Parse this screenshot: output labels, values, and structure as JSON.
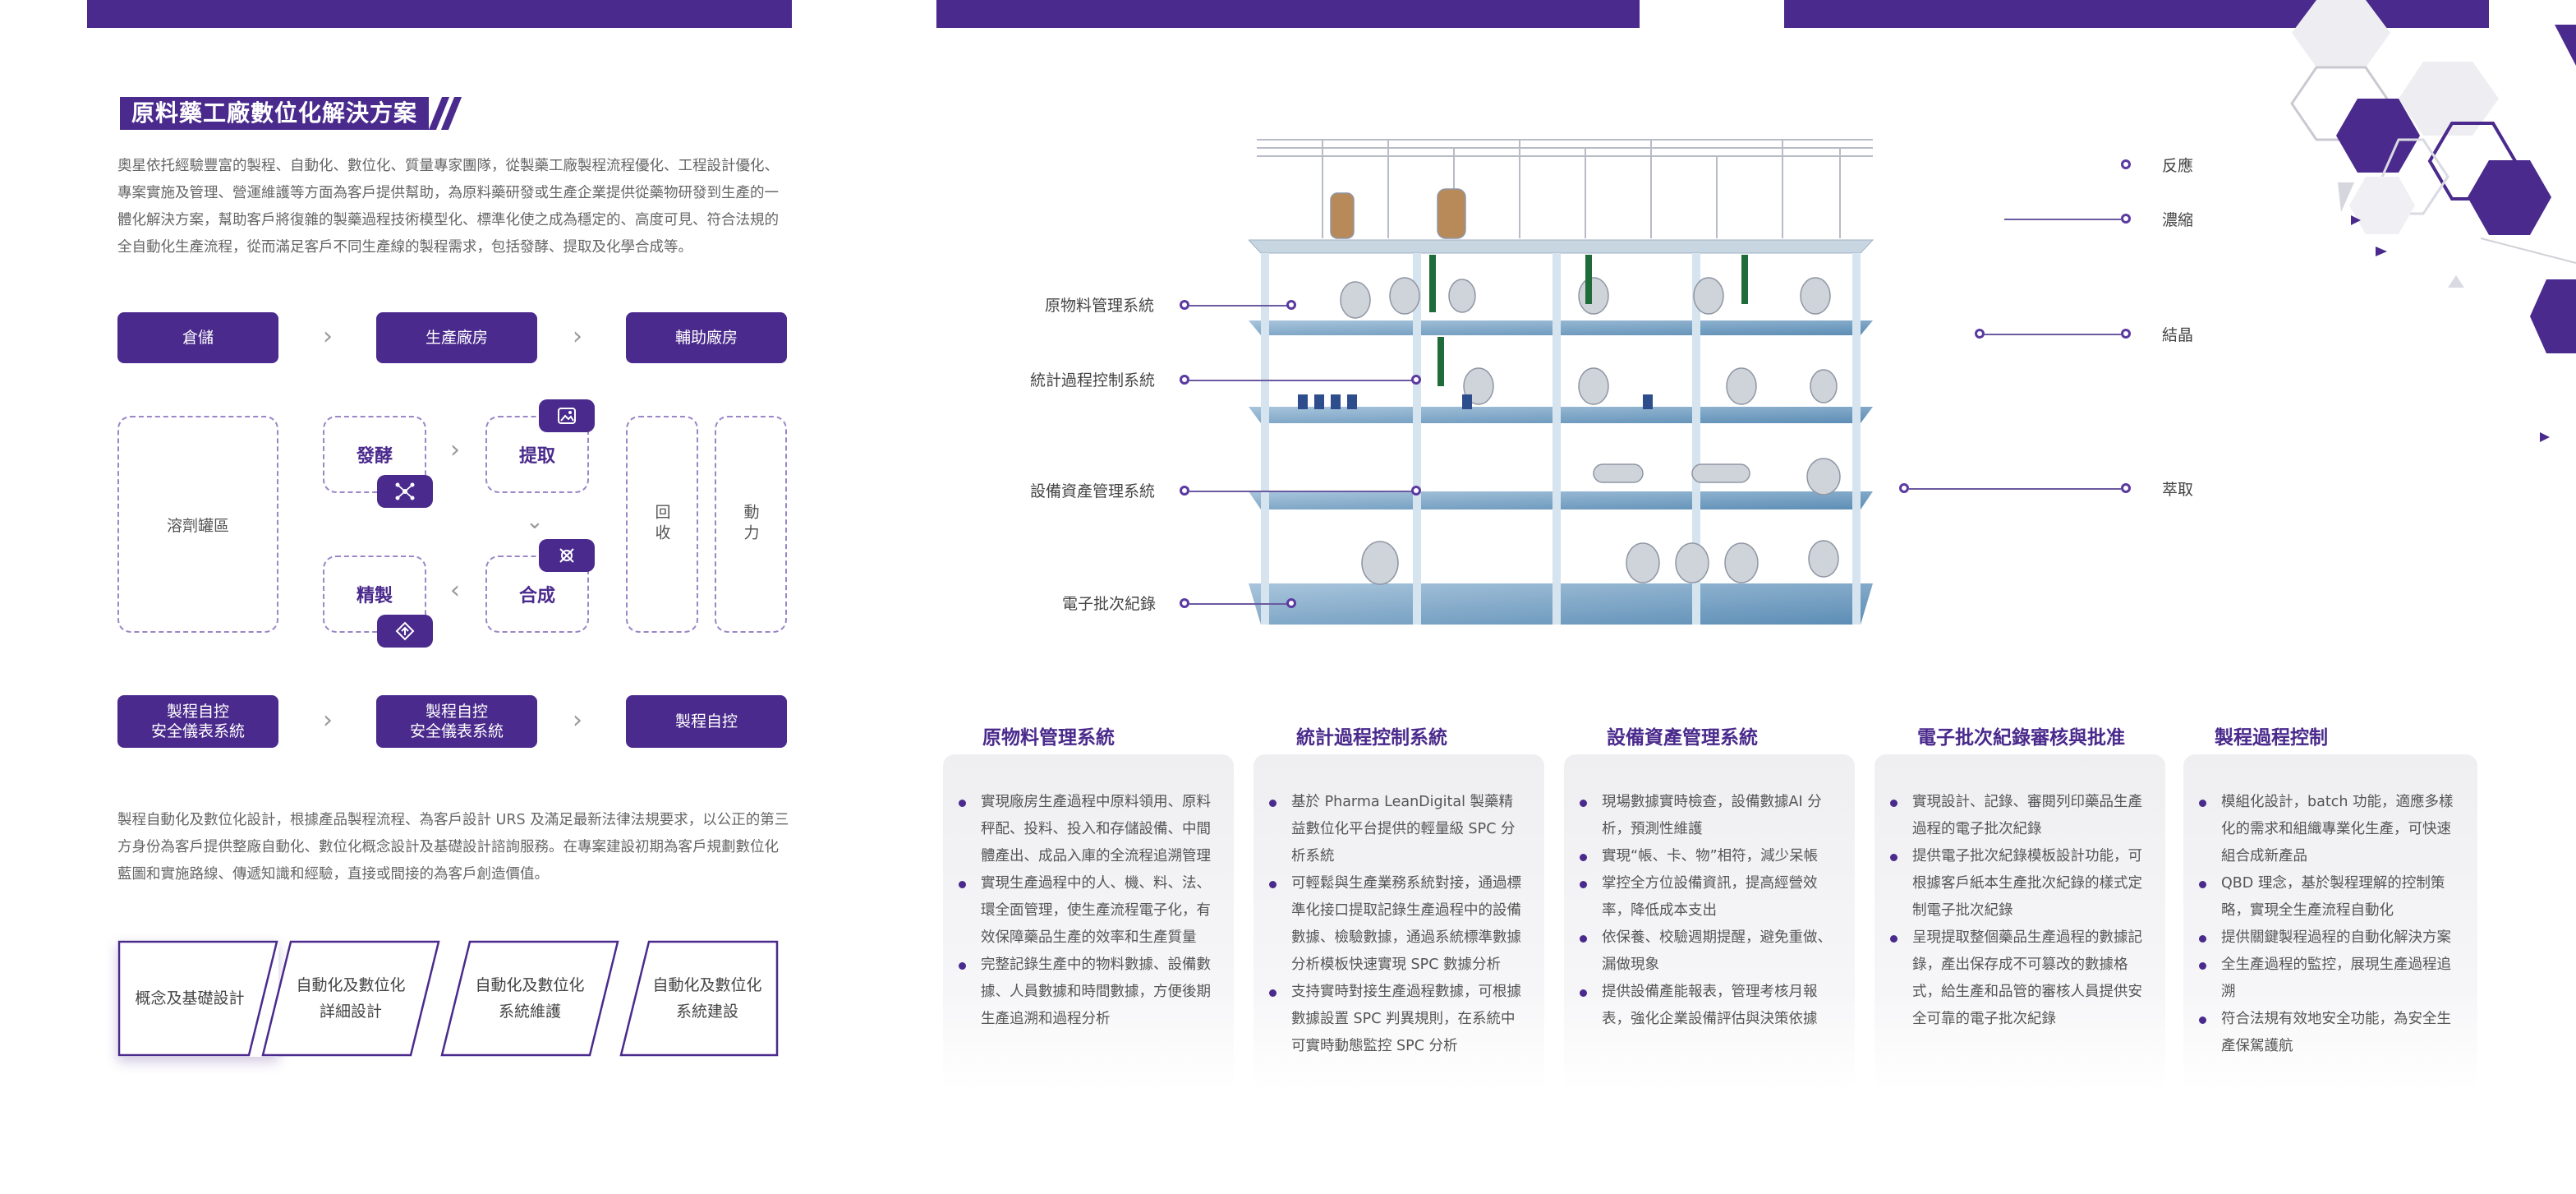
{
  "title": "原料藥工廠數位化解決方案",
  "intro": "奧星依托經驗豐富的製程、自動化、數位化、質量專家團隊，從製藥工廠製程流程優化、工程設計優化、專案實施及管理、營運維護等方面為客戶提供幫助，為原料藥研發或生產企業提供從藥物研發到生產的一體化解決方案，幫助客戶將復雜的製藥過程技術模型化、標準化使之成為穩定的、高度可見、符合法規的全自動化生產流程，從而滿足客戶不同生產線的製程需求，包括發酵、提取及化學合成等。",
  "flow": {
    "top": [
      "倉儲",
      "生產廠房",
      "輔助廠房"
    ],
    "solvent": "溶劑罐區",
    "steps": {
      "fermentation": "發酵",
      "extraction": "提取",
      "refining": "精製",
      "synthesis": "合成"
    },
    "recovery": "回收",
    "power": "動力",
    "bottom": [
      "製程自控\n安全儀表系統",
      "製程自控\n安全儀表系統",
      "製程自控"
    ]
  },
  "para2": "製程自動化及數位化設計，根據產品製程流程、為客戶設計 URS 及滿足最新法律法規要求，以公正的第三方身份為客戶提供整廠自動化、數位化概念設計及基礎設計諮詢服務。在專案建設初期為客戶規劃數位化藍圖和實施路線、傳遞知識和經驗，直接或間接的為客戶創造價值。",
  "services": [
    "概念及基礎設計",
    "自動化及數位化\n詳細設計",
    "自動化及數位化\n系統維護",
    "自動化及數位化\n系統建設"
  ],
  "diagram": {
    "left_labels": [
      "原物料管理系統",
      "統計過程控制系統",
      "設備資產管理系統",
      "電子批次紀錄"
    ],
    "right_labels": [
      "反應",
      "濃縮",
      "結晶",
      "萃取"
    ]
  },
  "systems": [
    {
      "title": "原物料管理系統",
      "items": [
        "實現廠房生產過程中原料領用、原料秤配、投料、投入和存儲設備、中間體產出、成品入庫的全流程追溯管理",
        "實現生產過程中的人、機、料、法、環全面管理，使生產流程電子化，有效保障藥品生產的效率和生產質量",
        "完整記錄生產中的物料數據、設備數據、人員數據和時間數據，方便後期生產追溯和過程分析"
      ]
    },
    {
      "title": "統計過程控制系統",
      "items": [
        "基於 Pharma LeanDigital 製藥精益數位化平台提供的輕量級 SPC 分析系統",
        "可輕鬆與生產業務系統對接，通過標準化接口提取記錄生產過程中的設備數據、檢驗數據，通過系統標準數據分析模板快速實現 SPC 數據分析",
        "支持實時對接生產過程數據，可根據數據設置 SPC 判異規則，在系統中可實時動態監控 SPC 分析"
      ]
    },
    {
      "title": "設備資產管理系統",
      "items": [
        "現場數據實時檢查，設備數據AI 分析，預測性維護",
        "實現“帳、卡、物”相符，減少呆帳",
        "掌控全方位設備資訊，提高經營效率，降低成本支出",
        "依保養、校驗週期提醒，避免重做、漏做現象",
        "提供設備產能報表，管理考核月報表，強化企業設備評估與決策依據"
      ]
    },
    {
      "title": "電子批次紀錄審核與批准",
      "items": [
        "實現設計、記錄、審閱列印藥品生產過程的電子批次紀錄",
        "提供電子批次紀錄模板設計功能，可根據客戶紙本生產批次紀錄的樣式定制電子批次紀錄",
        "呈現提取整個藥品生產過程的數據記錄，產出保存成不可篡改的數據格式，給生產和品管的審核人員提供安全可靠的電子批次紀錄"
      ]
    },
    {
      "title": "製程過程控制",
      "items": [
        "模組化設計，batch 功能，適應多樣化的需求和組織專業化生產，可快速組合成新產品",
        "QBD 理念，基於製程理解的控制策略，實現全生產流程自動化",
        "提供關鍵製程過程的自動化解決方案",
        "全生產過程的監控，展現生產過程追溯",
        "符合法規有效地安全功能，為安全生產保駕護航"
      ]
    }
  ],
  "colors": {
    "brand": "#4a2a8c",
    "dash": "#9a86c8",
    "text": "#555555"
  }
}
